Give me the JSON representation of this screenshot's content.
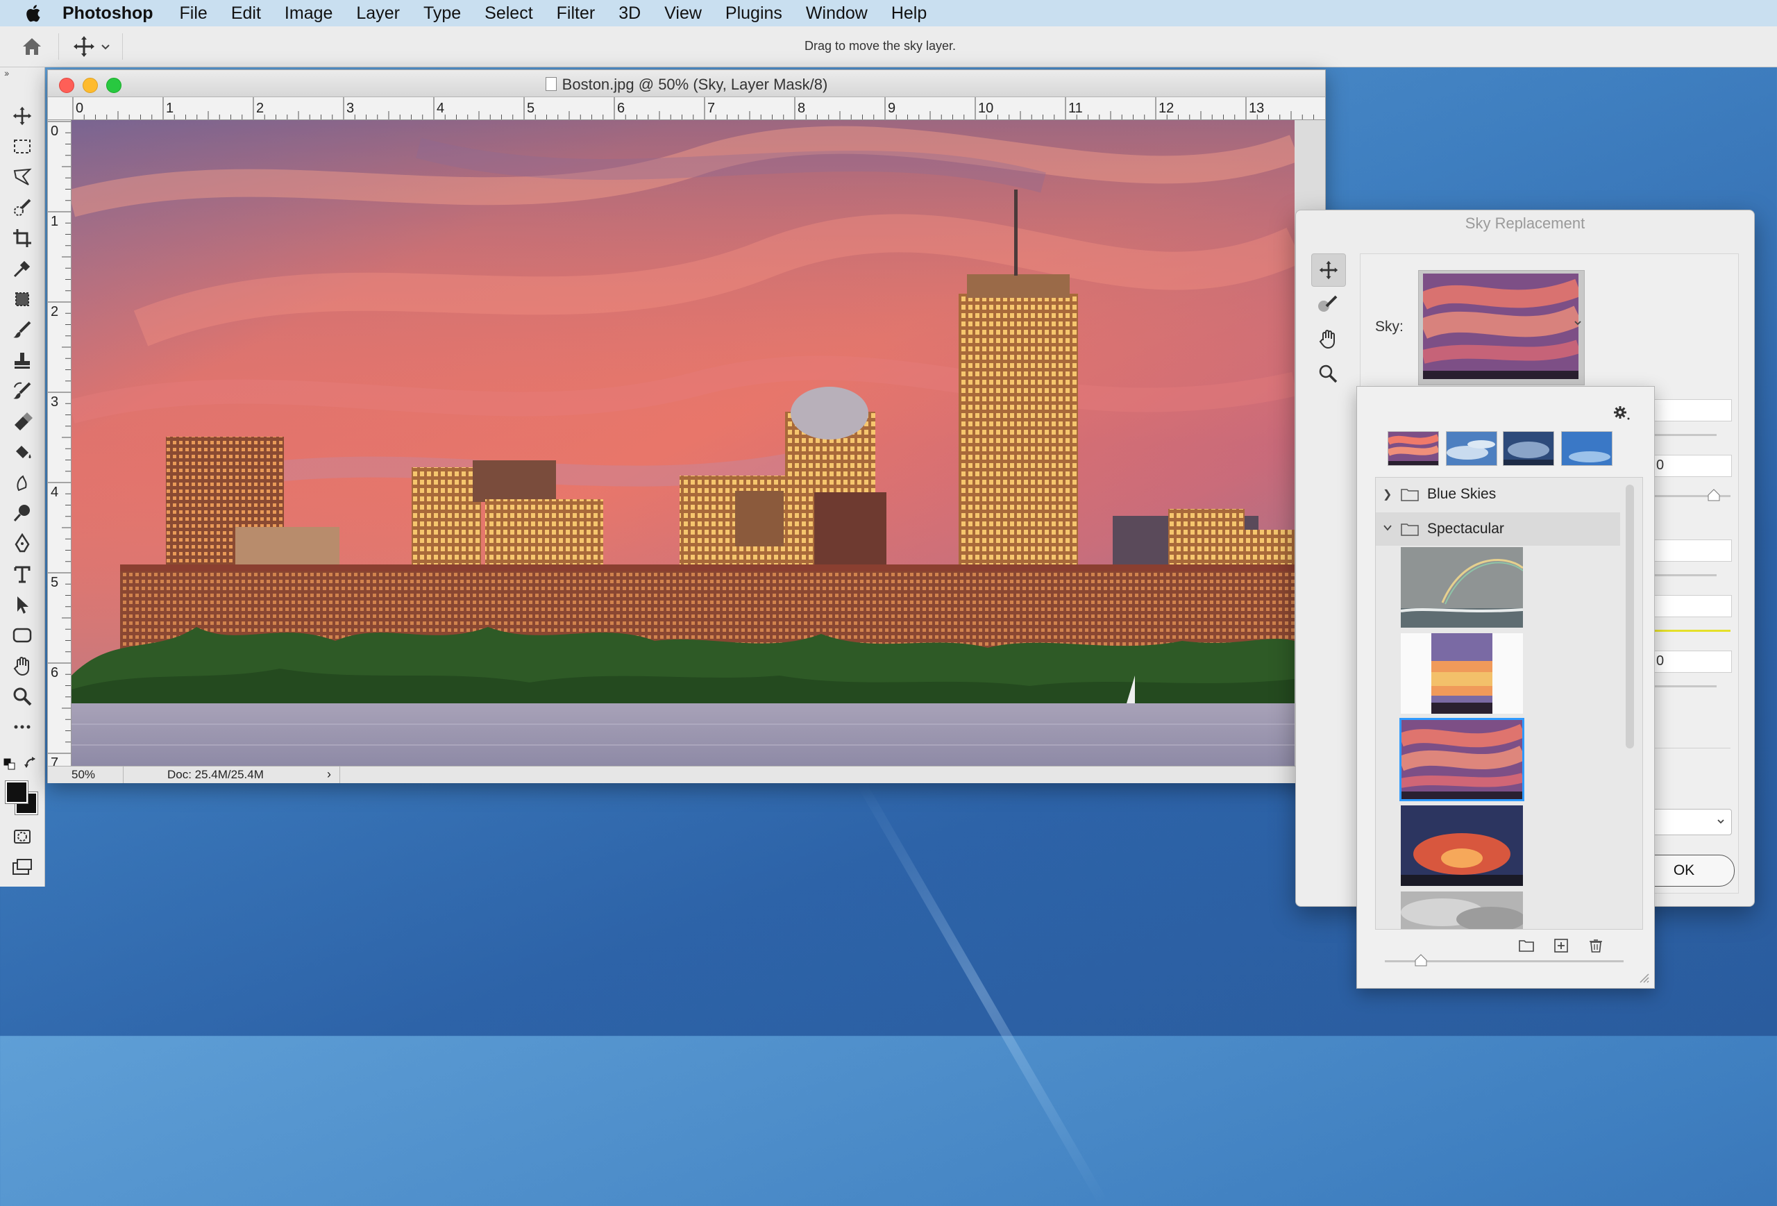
{
  "menubar": {
    "app_name": "Photoshop",
    "items": [
      "File",
      "Edit",
      "Image",
      "Layer",
      "Type",
      "Select",
      "Filter",
      "3D",
      "View",
      "Plugins",
      "Window",
      "Help"
    ]
  },
  "options_bar": {
    "hint": "Drag to move the sky layer."
  },
  "document": {
    "title": "Boston.jpg @ 50% (Sky, Layer Mask/8)",
    "zoom": "50%",
    "doc_size": "Doc: 25.4M/25.4M",
    "status_arrow": "›",
    "ruler_top": [
      "0",
      "1",
      "2",
      "3",
      "4",
      "5",
      "6",
      "7",
      "8",
      "9",
      "10",
      "11",
      "12",
      "13"
    ],
    "ruler_left": [
      "0",
      "1",
      "2",
      "3",
      "4",
      "5",
      "6",
      "7"
    ]
  },
  "sky_dialog": {
    "title": "Sky Replacement",
    "sky_label": "Sky:",
    "ok_label": "OK",
    "field_fragments": [
      "0",
      "0"
    ]
  },
  "presets": {
    "folders": [
      {
        "name": "Blue Skies",
        "expanded": false
      },
      {
        "name": "Spectacular",
        "expanded": true
      }
    ],
    "selected_index": 2
  },
  "colors": {
    "accent_selection": "#2e9aff",
    "menubar_bg": "#c9dff0",
    "close": "#fe5f57",
    "minimize": "#febb2e",
    "maximize": "#28c840"
  }
}
